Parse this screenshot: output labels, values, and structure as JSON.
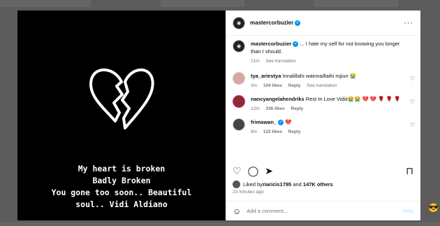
{
  "media": {
    "caption_lines": [
      "My heart is broken",
      "Badly Broken",
      "You gone too soon.. Beautiful",
      "soul.. Vidi Aldiano"
    ]
  },
  "header": {
    "username": "mastercorbuzier",
    "more": "···"
  },
  "comments": [
    {
      "username": "mastercorbuzier",
      "text": " ... I hate my self for not knowing you longer than I should.",
      "time": "21m",
      "likes": "",
      "reply": "",
      "translate": "See translation",
      "avatar_color": "#222222"
    },
    {
      "username": "tya_ariestya",
      "text": " Innalillahi wainnaillaihi rojiun 😭",
      "time": "3m",
      "likes": "104 likes",
      "reply": "Reply",
      "translate": "See translation",
      "avatar_color": "#d9a6a0"
    },
    {
      "username": "nancyangelahendriks",
      "text": " Rest In Love Vidiii😭😭 💔 💔 🌹 🌹 🌹",
      "time": "12m",
      "likes": "336 likes",
      "reply": "Reply",
      "translate": "",
      "avatar_color": "#8a2d2d"
    },
    {
      "username": "frimawan_",
      "text": " 💔",
      "time": "8m",
      "likes": "122 likes",
      "reply": "Reply",
      "translate": "",
      "avatar_color": "#444444"
    }
  ],
  "actions": {
    "like_icon": "heart-outline-icon",
    "comment_icon": "comment-icon",
    "share_icon": "share-icon",
    "save_icon": "bookmark-icon"
  },
  "likes": {
    "prefix": "Liked by ",
    "user": "riaricis1795",
    "middle": " and ",
    "count": "147K others"
  },
  "posted": "23 minutes ago",
  "add_comment": {
    "placeholder": "Add a comment...",
    "post": "Post"
  }
}
